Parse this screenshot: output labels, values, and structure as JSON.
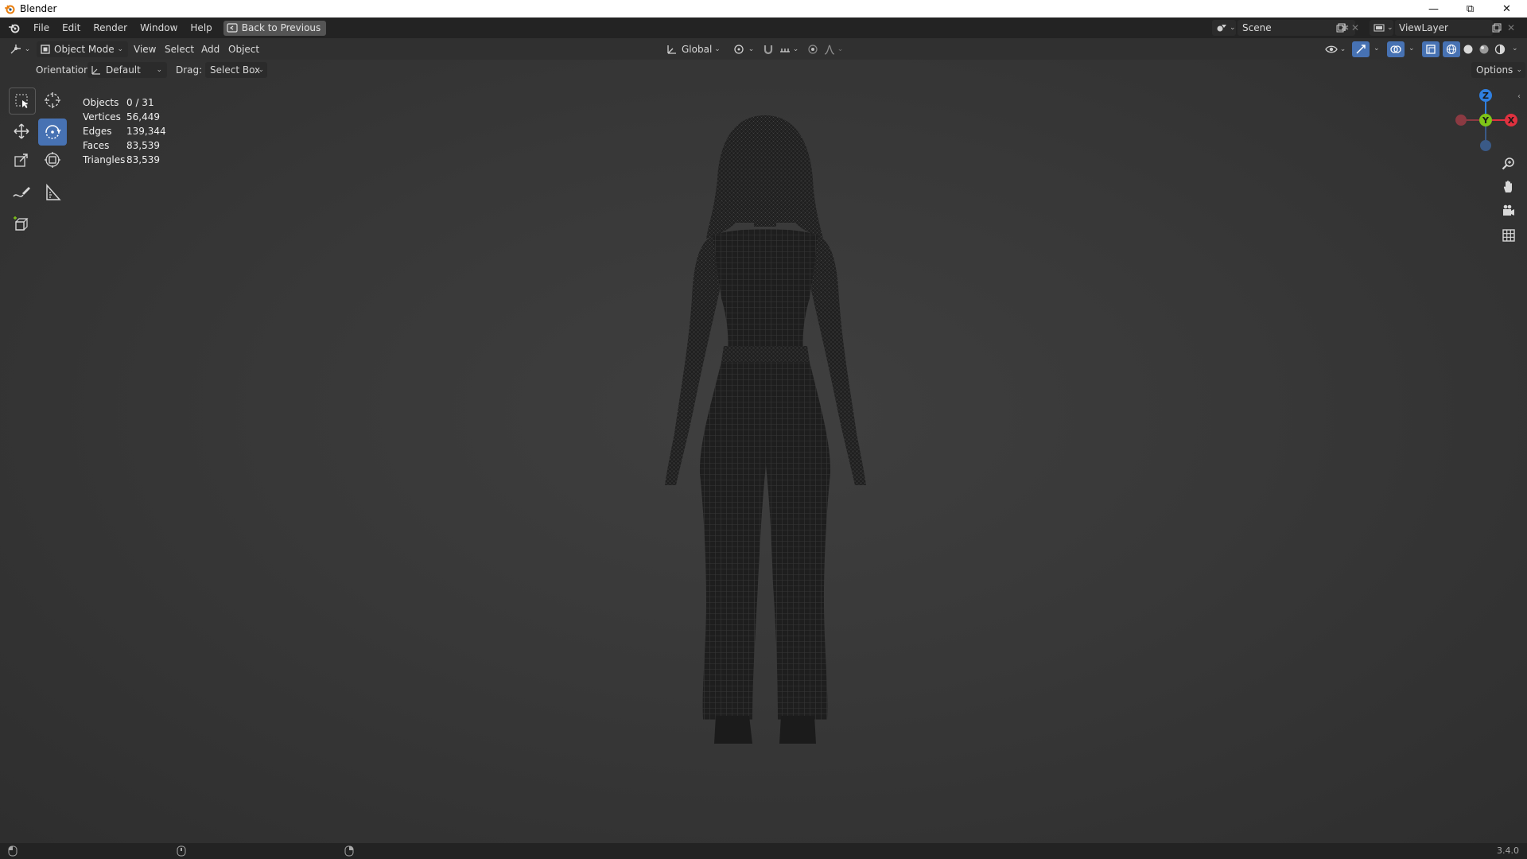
{
  "window": {
    "title": "Blender"
  },
  "menu": {
    "items": [
      "File",
      "Edit",
      "Render",
      "Window",
      "Help"
    ],
    "back_label": "Back to Previous"
  },
  "scene": {
    "name": "Scene"
  },
  "view_layer": {
    "name": "ViewLayer"
  },
  "viewport_header": {
    "mode": "Object Mode",
    "menus": [
      "View",
      "Select",
      "Add",
      "Object"
    ],
    "transform_orientation": "Global"
  },
  "tool_settings": {
    "orientation_label": "Orientation:",
    "orientation_value": "Default",
    "drag_label": "Drag:",
    "drag_value": "Select Box",
    "options_label": "Options"
  },
  "stats": [
    {
      "label": "Objects",
      "value": "0 / 31"
    },
    {
      "label": "Vertices",
      "value": "56,449"
    },
    {
      "label": "Edges",
      "value": "139,344"
    },
    {
      "label": "Faces",
      "value": "83,539"
    },
    {
      "label": "Triangles",
      "value": "83,539"
    }
  ],
  "gizmo": {
    "x": "X",
    "y": "Y",
    "z": "Z"
  },
  "status": {
    "version": "3.4.0"
  },
  "colors": {
    "accent": "#4772b3",
    "axis_x": "#e0313f",
    "axis_y": "#7fc518",
    "axis_z": "#2f7fe0"
  },
  "icons": {
    "tools": [
      "select-box-icon",
      "cursor-icon",
      "move-icon",
      "rotate-icon",
      "scale-icon",
      "transform-icon",
      "annotate-icon",
      "measure-icon",
      "add-cube-icon"
    ],
    "nav": [
      "zoom-icon",
      "hand-icon",
      "camera-icon",
      "grid-icon"
    ]
  }
}
